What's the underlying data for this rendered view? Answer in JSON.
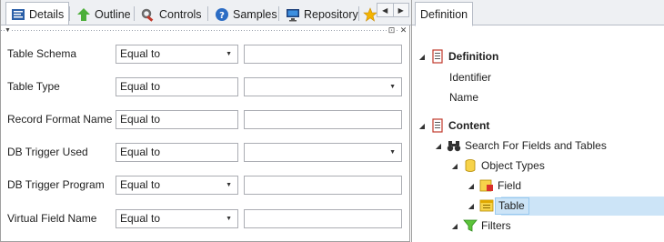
{
  "left_tabs": [
    {
      "label": "Details",
      "icon": "details-icon",
      "active": true
    },
    {
      "label": "Outline",
      "icon": "outline-icon",
      "active": false
    },
    {
      "label": "Controls",
      "icon": "controls-icon",
      "active": false
    },
    {
      "label": "Samples",
      "icon": "samples-icon",
      "active": false
    },
    {
      "label": "Repository",
      "icon": "repository-icon",
      "active": false
    }
  ],
  "filters": [
    {
      "label": "Table Schema",
      "operator": "Equal to",
      "operator_dropdown": true,
      "value_dropdown": false
    },
    {
      "label": "Table Type",
      "operator": "Equal to",
      "operator_dropdown": false,
      "value_dropdown": true
    },
    {
      "label": "Record Format Name",
      "operator": "Equal to",
      "operator_dropdown": false,
      "value_dropdown": false
    },
    {
      "label": "DB Trigger Used",
      "operator": "Equal to",
      "operator_dropdown": false,
      "value_dropdown": true
    },
    {
      "label": "DB Trigger Program",
      "operator": "Equal to",
      "operator_dropdown": true,
      "value_dropdown": false
    },
    {
      "label": "Virtual Field Name",
      "operator": "Equal to",
      "operator_dropdown": true,
      "value_dropdown": false
    }
  ],
  "right_tab": {
    "label": "Definition"
  },
  "tree": {
    "definition": {
      "label": "Definition",
      "children": [
        "Identifier",
        "Name"
      ]
    },
    "content": {
      "label": "Content"
    },
    "search": {
      "label": "Search For Fields and Tables"
    },
    "object_types": {
      "label": "Object Types"
    },
    "field": {
      "label": "Field"
    },
    "table": {
      "label": "Table",
      "selected": true
    },
    "filters": {
      "label": "Filters"
    }
  },
  "colors": {
    "selection": "#cce4f7",
    "tab_background": "#eef0f3",
    "border": "#abadb3"
  }
}
